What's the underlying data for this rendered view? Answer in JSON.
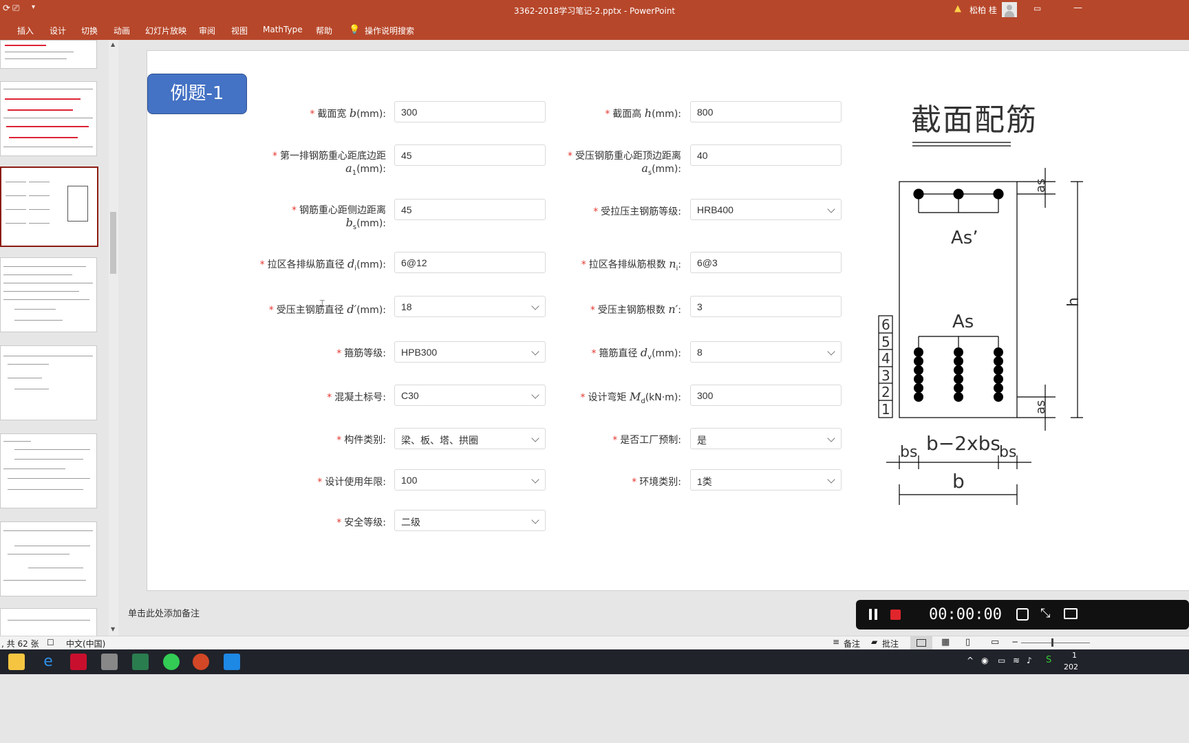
{
  "window": {
    "title": "3362-2018学习笔记-2.pptx  -  PowerPoint",
    "user": "松柏 桂"
  },
  "ribbon": {
    "tabs": [
      "插入",
      "设计",
      "切换",
      "动画",
      "幻灯片放映",
      "审阅",
      "视图",
      "MathType",
      "帮助"
    ],
    "search": "操作说明搜索"
  },
  "slide": {
    "badge": "例题-1",
    "form": {
      "section_width_label": "截面宽 ",
      "section_width_var": "b",
      "section_width_unit": "(mm):",
      "section_width_value": "300",
      "section_height_label": "截面高 ",
      "section_height_var": "h",
      "section_height_unit": "(mm):",
      "section_height_value": "800",
      "a1_label": "第一排钢筋重心距底边距",
      "a1_var": "a",
      "a1_sub": "1",
      "a1_unit": "(mm):",
      "a1_value": "45",
      "as_prime_label": "受压钢筋重心距顶边距离",
      "as_prime_var": "a",
      "as_prime_sub": "s",
      "as_prime_unit": "(mm):",
      "as_prime_value": "40",
      "bs_label": "钢筋重心距侧边距离",
      "bs_var": "b",
      "bs_sub": "s",
      "bs_unit": "(mm):",
      "bs_value": "45",
      "steel_grade_label": "受拉压主钢筋等级:",
      "steel_grade_value": "HRB400",
      "di_label": "拉区各排纵筋直径 ",
      "di_var": "d",
      "di_sub": "i",
      "di_unit": "(mm):",
      "di_value": "6@12",
      "ni_label": "拉区各排纵筋根数 ",
      "ni_var": "n",
      "ni_sub": "i",
      "ni_unit": ":",
      "ni_value": "6@3",
      "dprime_label": "受压主钢筋直径 ",
      "dprime_var": "d′",
      "dprime_unit": "(mm):",
      "dprime_value": "18",
      "nprime_label": "受压主钢筋根数 ",
      "nprime_var": "n′",
      "nprime_unit": ":",
      "nprime_value": "3",
      "stirrup_grade_label": "箍筋等级:",
      "stirrup_grade_value": "HPB300",
      "stirrup_dia_label": "箍筋直径 ",
      "stirrup_dia_var": "d",
      "stirrup_dia_sub": "v",
      "stirrup_dia_unit": "(mm):",
      "stirrup_dia_value": "8",
      "concrete_label": "混凝土标号:",
      "concrete_value": "C30",
      "moment_label": "设计弯矩 ",
      "moment_var": "M",
      "moment_sub": "d",
      "moment_unit": "(kN·m):",
      "moment_value": "300",
      "member_type_label": "构件类别:",
      "member_type_value": "梁、板、塔、拱圈",
      "prefab_label": "是否工厂预制:",
      "prefab_value": "是",
      "service_life_label": "设计使用年限:",
      "service_life_value": "100",
      "env_label": "环境类别:",
      "env_value": "1类",
      "safety_label": "安全等级:",
      "safety_value": "二级",
      "required_mark": "*"
    },
    "figure": {
      "title": "截面配筋",
      "as_prime": "As’",
      "as": "As",
      "row_numbers": [
        "6",
        "5",
        "4",
        "3",
        "2",
        "1"
      ],
      "bs_left": "bs",
      "b_minus": "b−2xbs",
      "bs_right": "bs",
      "b": "b",
      "h": "h",
      "as_top": "as",
      "as_bottom": "as"
    }
  },
  "notes": {
    "placeholder": "单击此处添加备注"
  },
  "status": {
    "slide_count": ", 共 62 张",
    "language": "中文(中国)",
    "notes_btn": "备注",
    "comments_btn": "批注"
  },
  "recorder": {
    "time": "00:00:00"
  },
  "taskbar": {
    "clock_top": "1",
    "clock_bottom": "202"
  }
}
